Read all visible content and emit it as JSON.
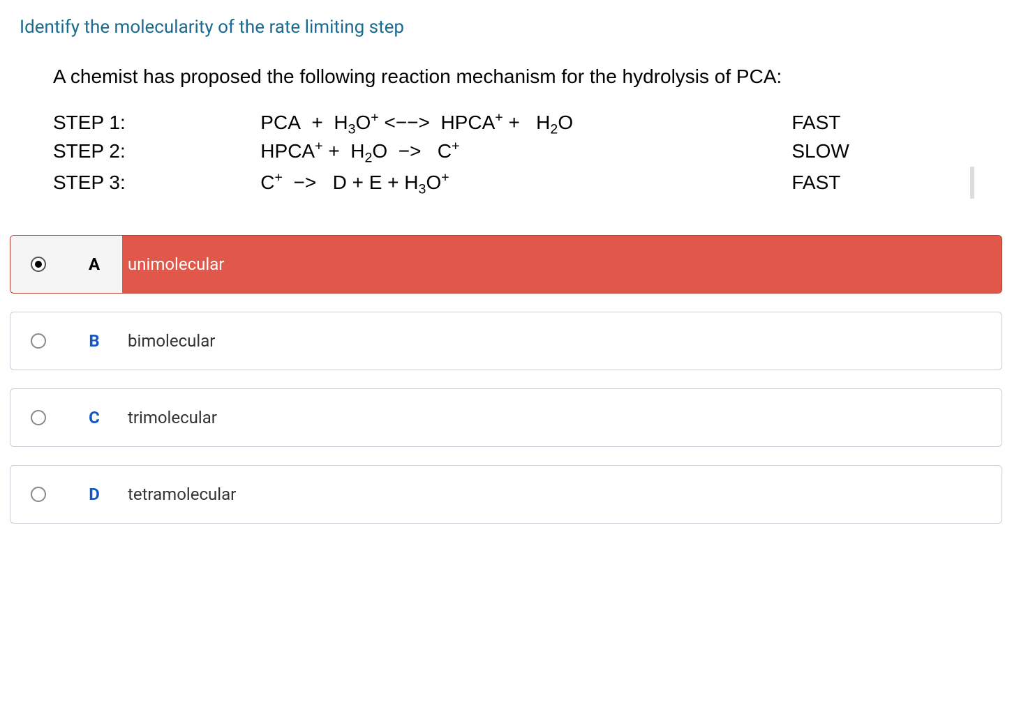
{
  "question": {
    "title": "Identify the molecularity of the rate limiting step",
    "intro": "A chemist has proposed the following reaction mechanism for the hydrolysis of PCA:",
    "steps": [
      {
        "label": "STEP 1:",
        "equation_html": "PCA&nbsp; +&nbsp;&nbsp;H<sub>3</sub>O<sup>+</sup> &lt;−−&gt;&nbsp; HPCA<sup>+</sup> +&nbsp;&nbsp;&nbsp;H<sub>2</sub>O",
        "rate": "FAST"
      },
      {
        "label": "STEP 2:",
        "equation_html": "HPCA<sup>+</sup> +&nbsp;&nbsp;H<sub>2</sub>O&nbsp; −&gt;&nbsp;&nbsp; C<sup>+</sup>",
        "rate": "SLOW"
      },
      {
        "label": "STEP 3:",
        "equation_html": "C<sup>+</sup>&nbsp; −&gt;&nbsp;&nbsp; D + E + H<sub>3</sub>O<sup>+</sup>",
        "rate": "FAST"
      }
    ]
  },
  "options": [
    {
      "letter": "A",
      "text": "unimolecular",
      "selected": true,
      "state": "wrong"
    },
    {
      "letter": "B",
      "text": "bimolecular",
      "selected": false,
      "state": "normal"
    },
    {
      "letter": "C",
      "text": "trimolecular",
      "selected": false,
      "state": "normal"
    },
    {
      "letter": "D",
      "text": "tetramolecular",
      "selected": false,
      "state": "normal"
    }
  ]
}
